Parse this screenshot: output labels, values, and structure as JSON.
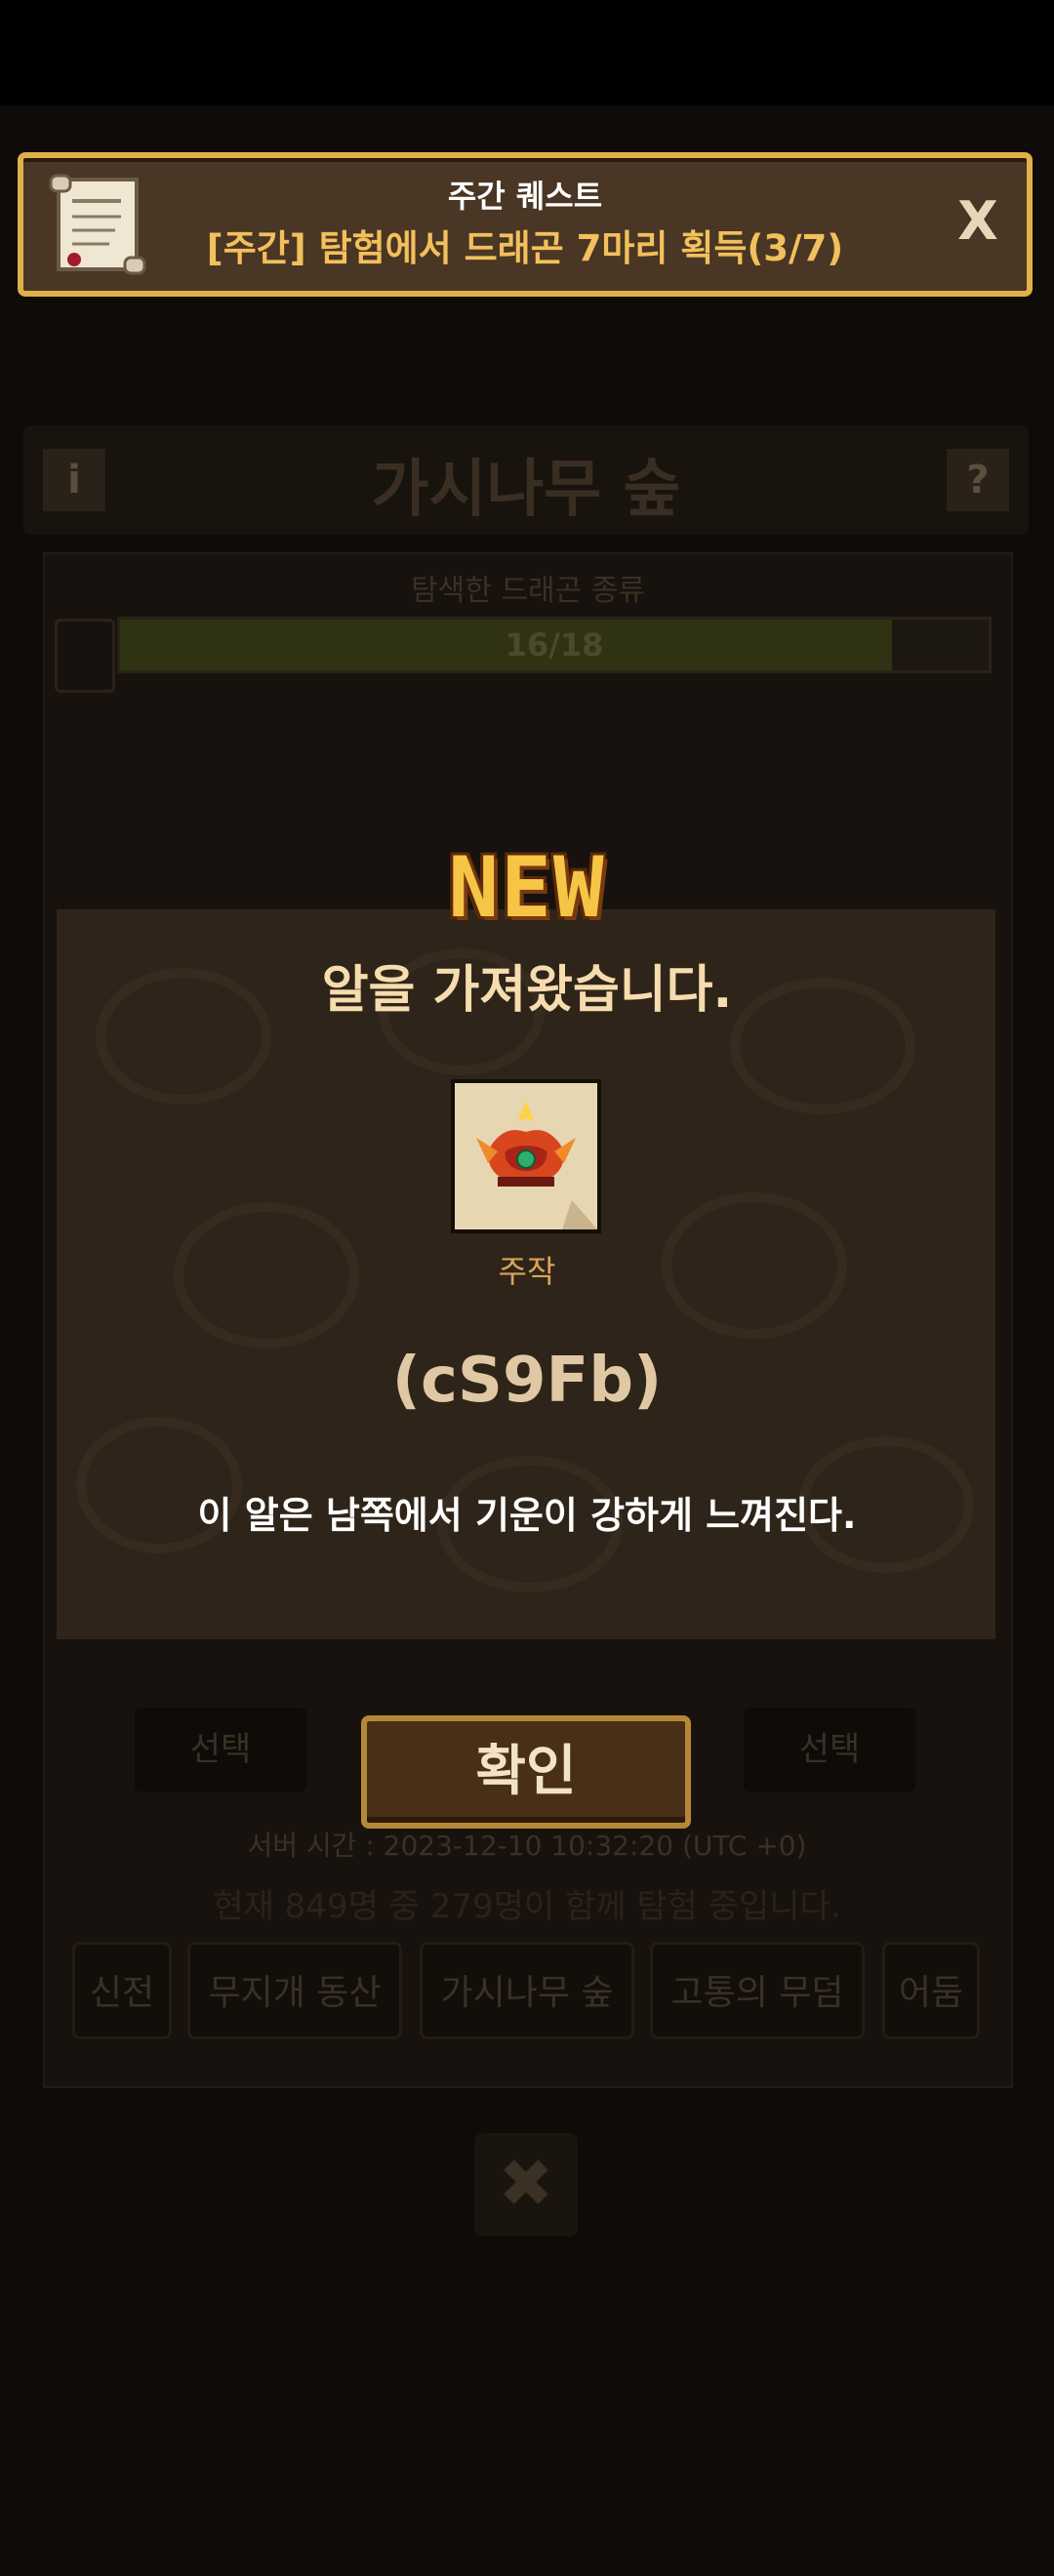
{
  "quest": {
    "title": "주간 퀘스트",
    "description": "[주간] 탐험에서 드래곤 7마리 획득(3/7)",
    "close_label": "X"
  },
  "background": {
    "location_title": "가시나무 숲",
    "info_label": "i",
    "help_label": "?",
    "progress_label": "탐색한 드래곤 종류",
    "progress_text": "16/18",
    "progress_value": 0.889,
    "choice_label": "선택",
    "server_time": "서버 시간 : 2023-12-10 10:32:20 (UTC +0)",
    "users_line": "현재 849명 중 279명이 함께 탐험 중입니다.",
    "tabs": [
      "신전",
      "무지개 동산",
      "가시나무 숲",
      "고통의 무덤",
      "어둠의"
    ],
    "close_label": "✖"
  },
  "popup": {
    "badge": "NEW",
    "headline": "알을 가져왔습니다.",
    "egg_type": "주작",
    "egg_code": "(cS9Fb)",
    "egg_description": "이 알은 남쪽에서 기운이 강하게 느껴진다.",
    "confirm_label": "확인"
  },
  "colors": {
    "banner_border": "#e0b04a",
    "accent_text": "#f2c05c",
    "popup_bg": "#2f2419"
  }
}
